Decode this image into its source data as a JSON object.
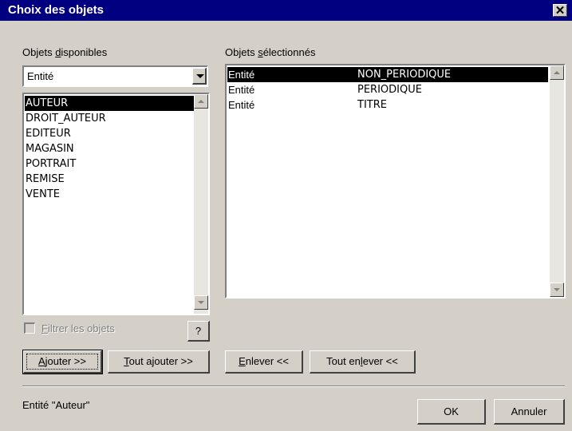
{
  "window": {
    "title": "Choix des objets",
    "close_icon": "close-icon"
  },
  "available": {
    "label_pre": "Objets ",
    "label_ul": "d",
    "label_post": "isponibles",
    "dropdown_value": "Entité",
    "items": [
      "AUTEUR",
      "DROIT_AUTEUR",
      "EDITEUR",
      "MAGASIN",
      "PORTRAIT",
      "REMISE",
      "VENTE"
    ],
    "selected_index": 0
  },
  "selected": {
    "label_pre": "Objets ",
    "label_ul": "s",
    "label_post": "électionnés",
    "rows": [
      {
        "type": "Entité",
        "name": "NON_PERIODIQUE"
      },
      {
        "type": "Entité",
        "name": "PERIODIQUE"
      },
      {
        "type": "Entité",
        "name": "TITRE"
      }
    ],
    "selected_index": 0
  },
  "filter": {
    "label_ul": "F",
    "label_post": "iltrer les objets",
    "checked": false,
    "help_label": "?"
  },
  "buttons": {
    "add_ul": "A",
    "add_post": "jouter >>",
    "add_all_ul": "T",
    "add_all_post": "out ajouter >>",
    "remove_ul": "E",
    "remove_post": "nlever <<",
    "remove_all_pre": "Tout en",
    "remove_all_ul": "l",
    "remove_all_post": "ever <<",
    "ok": "OK",
    "cancel": "Annuler"
  },
  "status": {
    "text": "Entité \"Auteur\""
  }
}
